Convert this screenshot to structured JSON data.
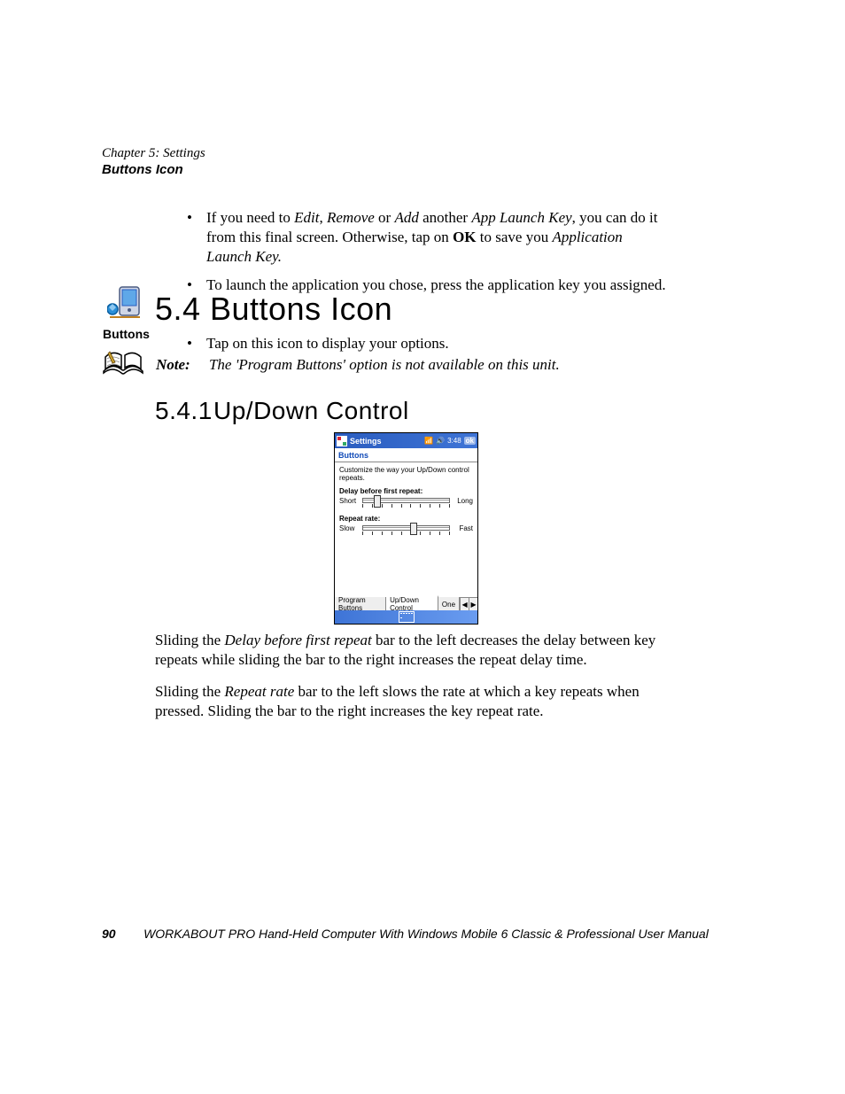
{
  "chapter_line": "Chapter 5: Settings",
  "chapter_sub": "Buttons Icon",
  "bullets": {
    "b1_pre": "If you need to ",
    "b1_edit": "Edit",
    "b1_remove": "Remove",
    "b1_add": "Add",
    "b1_mid1": ", ",
    "b1_mid2": " or ",
    "b1_mid3": " another ",
    "b1_alk": "App Launch Key",
    "b1_mid4": ", you can do it from this final screen. Otherwise, tap on ",
    "b1_ok": "OK",
    "b1_mid5": " to save you ",
    "b1_alk2": "Application Launch Key.",
    "b2": "To launch the application you chose, press the application key you assigned."
  },
  "h1": {
    "num": "5.4",
    "title": "Buttons Icon"
  },
  "tap_line": "Tap on this icon to display your options.",
  "note": {
    "label": "Note:",
    "text": "The 'Program Buttons' option is not available on this unit."
  },
  "h2": {
    "num": "5.4.1",
    "title": "Up/Down Control"
  },
  "buttons_icon_label": "Buttons",
  "screenshot": {
    "title": "Settings",
    "time": "3:48",
    "ok": "ok",
    "section": "Buttons",
    "desc": "Customize the way your Up/Down control repeats.",
    "delay_label": "Delay before first repeat:",
    "short": "Short",
    "long": "Long",
    "repeat_label": "Repeat rate:",
    "slow": "Slow",
    "fast": "Fast",
    "tabs": {
      "t1": "Program Buttons",
      "t2": "Up/Down Control",
      "t3": "One"
    }
  },
  "post": {
    "p1_a": "Sliding the ",
    "p1_em": "Delay before first repeat",
    "p1_b": " bar to the left decreases the delay between key repeats while sliding the bar to the right increases the repeat delay time.",
    "p2_a": "Sliding the ",
    "p2_em": "Repeat rate",
    "p2_b": " bar to the left slows the rate at which a key repeats when pressed. Sliding the bar to the right increases the key repeat rate."
  },
  "footer": {
    "page": "90",
    "text": "WORKABOUT PRO Hand-Held Computer With Windows Mobile 6 Classic & Professional User Manual"
  }
}
